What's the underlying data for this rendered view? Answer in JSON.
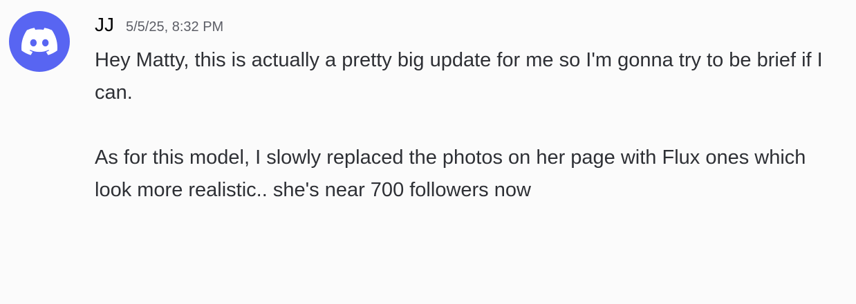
{
  "message": {
    "author": "JJ",
    "timestamp": "5/5/25, 8:32 PM",
    "avatar_icon": "discord-logo-icon",
    "avatar_color": "#5865f2",
    "paragraphs": [
      "Hey Matty, this is actually a pretty big update for me so I'm gonna try to be brief if I can.",
      "As for this model, I slowly replaced the photos on her page with Flux ones which look more realistic..  she's near 700 followers now"
    ]
  }
}
